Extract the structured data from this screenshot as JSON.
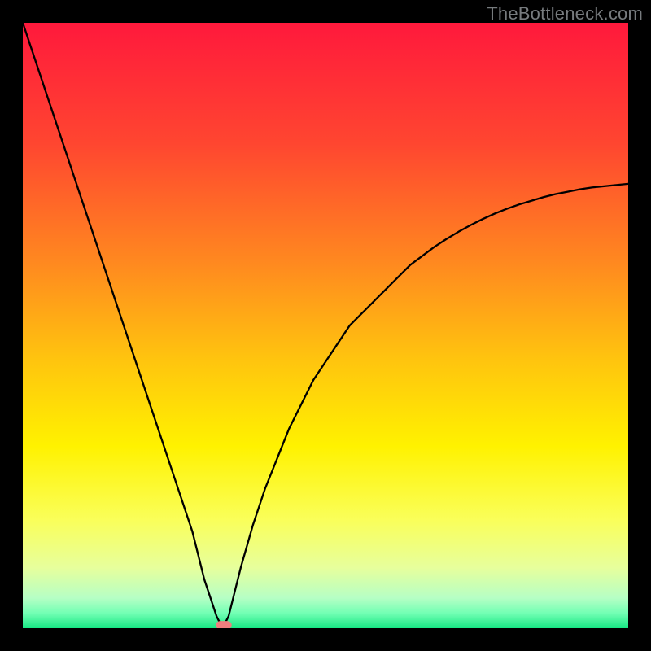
{
  "watermark": "TheBottleneck.com",
  "chart_data": {
    "type": "line",
    "title": "",
    "xlabel": "",
    "ylabel": "",
    "xlim": [
      0,
      100
    ],
    "ylim": [
      0,
      100
    ],
    "background": {
      "kind": "vertical-gradient",
      "stops": [
        {
          "pos": 0.0,
          "color": "#ff193c"
        },
        {
          "pos": 0.2,
          "color": "#ff4630"
        },
        {
          "pos": 0.4,
          "color": "#ff8a1f"
        },
        {
          "pos": 0.55,
          "color": "#ffc20f"
        },
        {
          "pos": 0.7,
          "color": "#fff200"
        },
        {
          "pos": 0.82,
          "color": "#faff59"
        },
        {
          "pos": 0.9,
          "color": "#e7ff9c"
        },
        {
          "pos": 0.95,
          "color": "#b6ffc5"
        },
        {
          "pos": 0.975,
          "color": "#73ffb4"
        },
        {
          "pos": 1.0,
          "color": "#17e884"
        }
      ]
    },
    "series": [
      {
        "name": "curve",
        "stroke": "#000000",
        "stroke_width": 2.3,
        "comment": "V-shaped curve; y≈100 at x=0, dips to y≈0 near x≈33, rises toward y≈73 at x=100 with decreasing slope",
        "x": [
          0,
          2,
          4,
          6,
          8,
          10,
          12,
          14,
          16,
          18,
          20,
          22,
          24,
          26,
          28,
          30,
          31,
          32,
          33,
          34,
          35,
          36,
          38,
          40,
          42,
          44,
          46,
          48,
          50,
          52,
          54,
          56,
          58,
          60,
          62,
          64,
          66,
          68,
          70,
          72,
          74,
          76,
          78,
          80,
          82,
          84,
          86,
          88,
          90,
          92,
          94,
          96,
          98,
          100
        ],
        "y": [
          100,
          94,
          88,
          82,
          76,
          70,
          64,
          58,
          52,
          46,
          40,
          34,
          28,
          22,
          16,
          8,
          5,
          2,
          0,
          2,
          6,
          10,
          17,
          23,
          28,
          33,
          37,
          41,
          44,
          47,
          50,
          52,
          54,
          56,
          58,
          60,
          61.5,
          63,
          64.3,
          65.5,
          66.6,
          67.6,
          68.5,
          69.3,
          70,
          70.6,
          71.2,
          71.7,
          72.1,
          72.5,
          72.8,
          73.0,
          73.2,
          73.4
        ]
      }
    ],
    "marker": {
      "comment": "small pink blob at curve minimum",
      "x": 33.2,
      "y": 0.5,
      "w": 2.6,
      "h": 1.4,
      "rx": 0.7,
      "fill": "#ef7f7f"
    }
  }
}
